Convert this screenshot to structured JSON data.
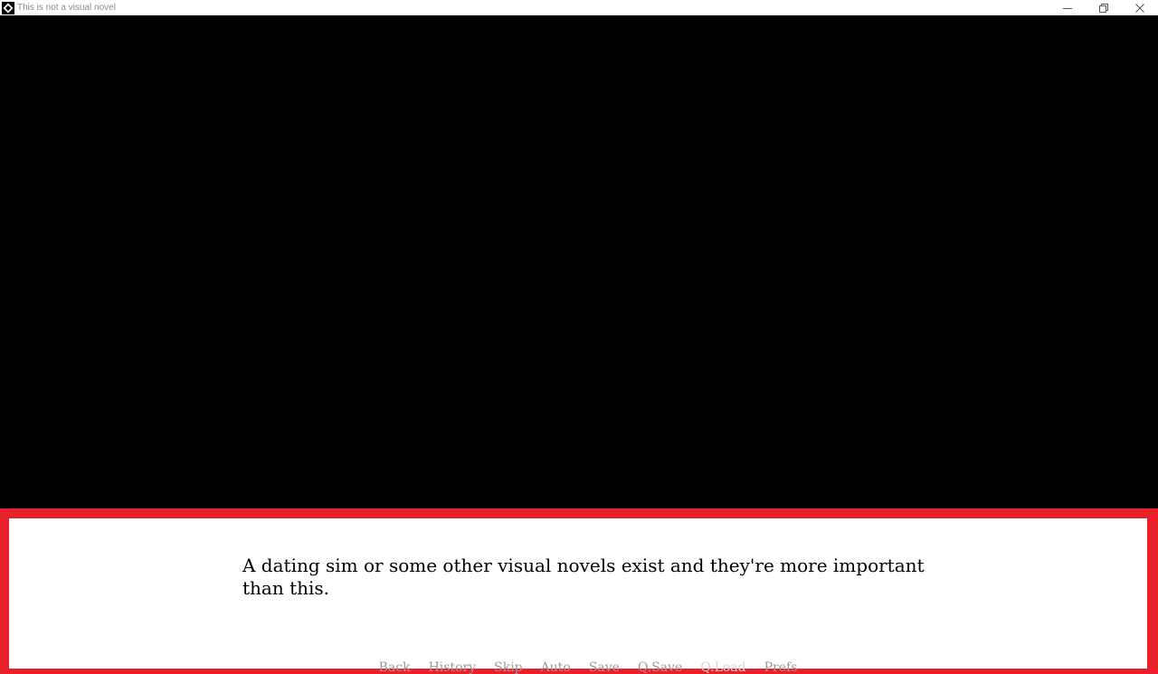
{
  "window": {
    "title": "This is not a visual novel",
    "icon": "diamond-app-icon",
    "controls": [
      "minimize-icon",
      "restore-icon",
      "close-icon"
    ]
  },
  "colors": {
    "textbox_border": "#e8202a",
    "textbox_bg": "#ffffff",
    "quick_menu_text": "#9a9a9a",
    "quick_menu_disabled": "#d6d6d6"
  },
  "dialogue": {
    "text": "A dating sim or some other visual novels exist and they're more important than this."
  },
  "quick_menu": {
    "back": "Back",
    "history": "History",
    "skip": "Skip",
    "auto": "Auto",
    "save": "Save",
    "qsave": "Q.Save",
    "qload": "Q.Load",
    "prefs": "Prefs"
  }
}
